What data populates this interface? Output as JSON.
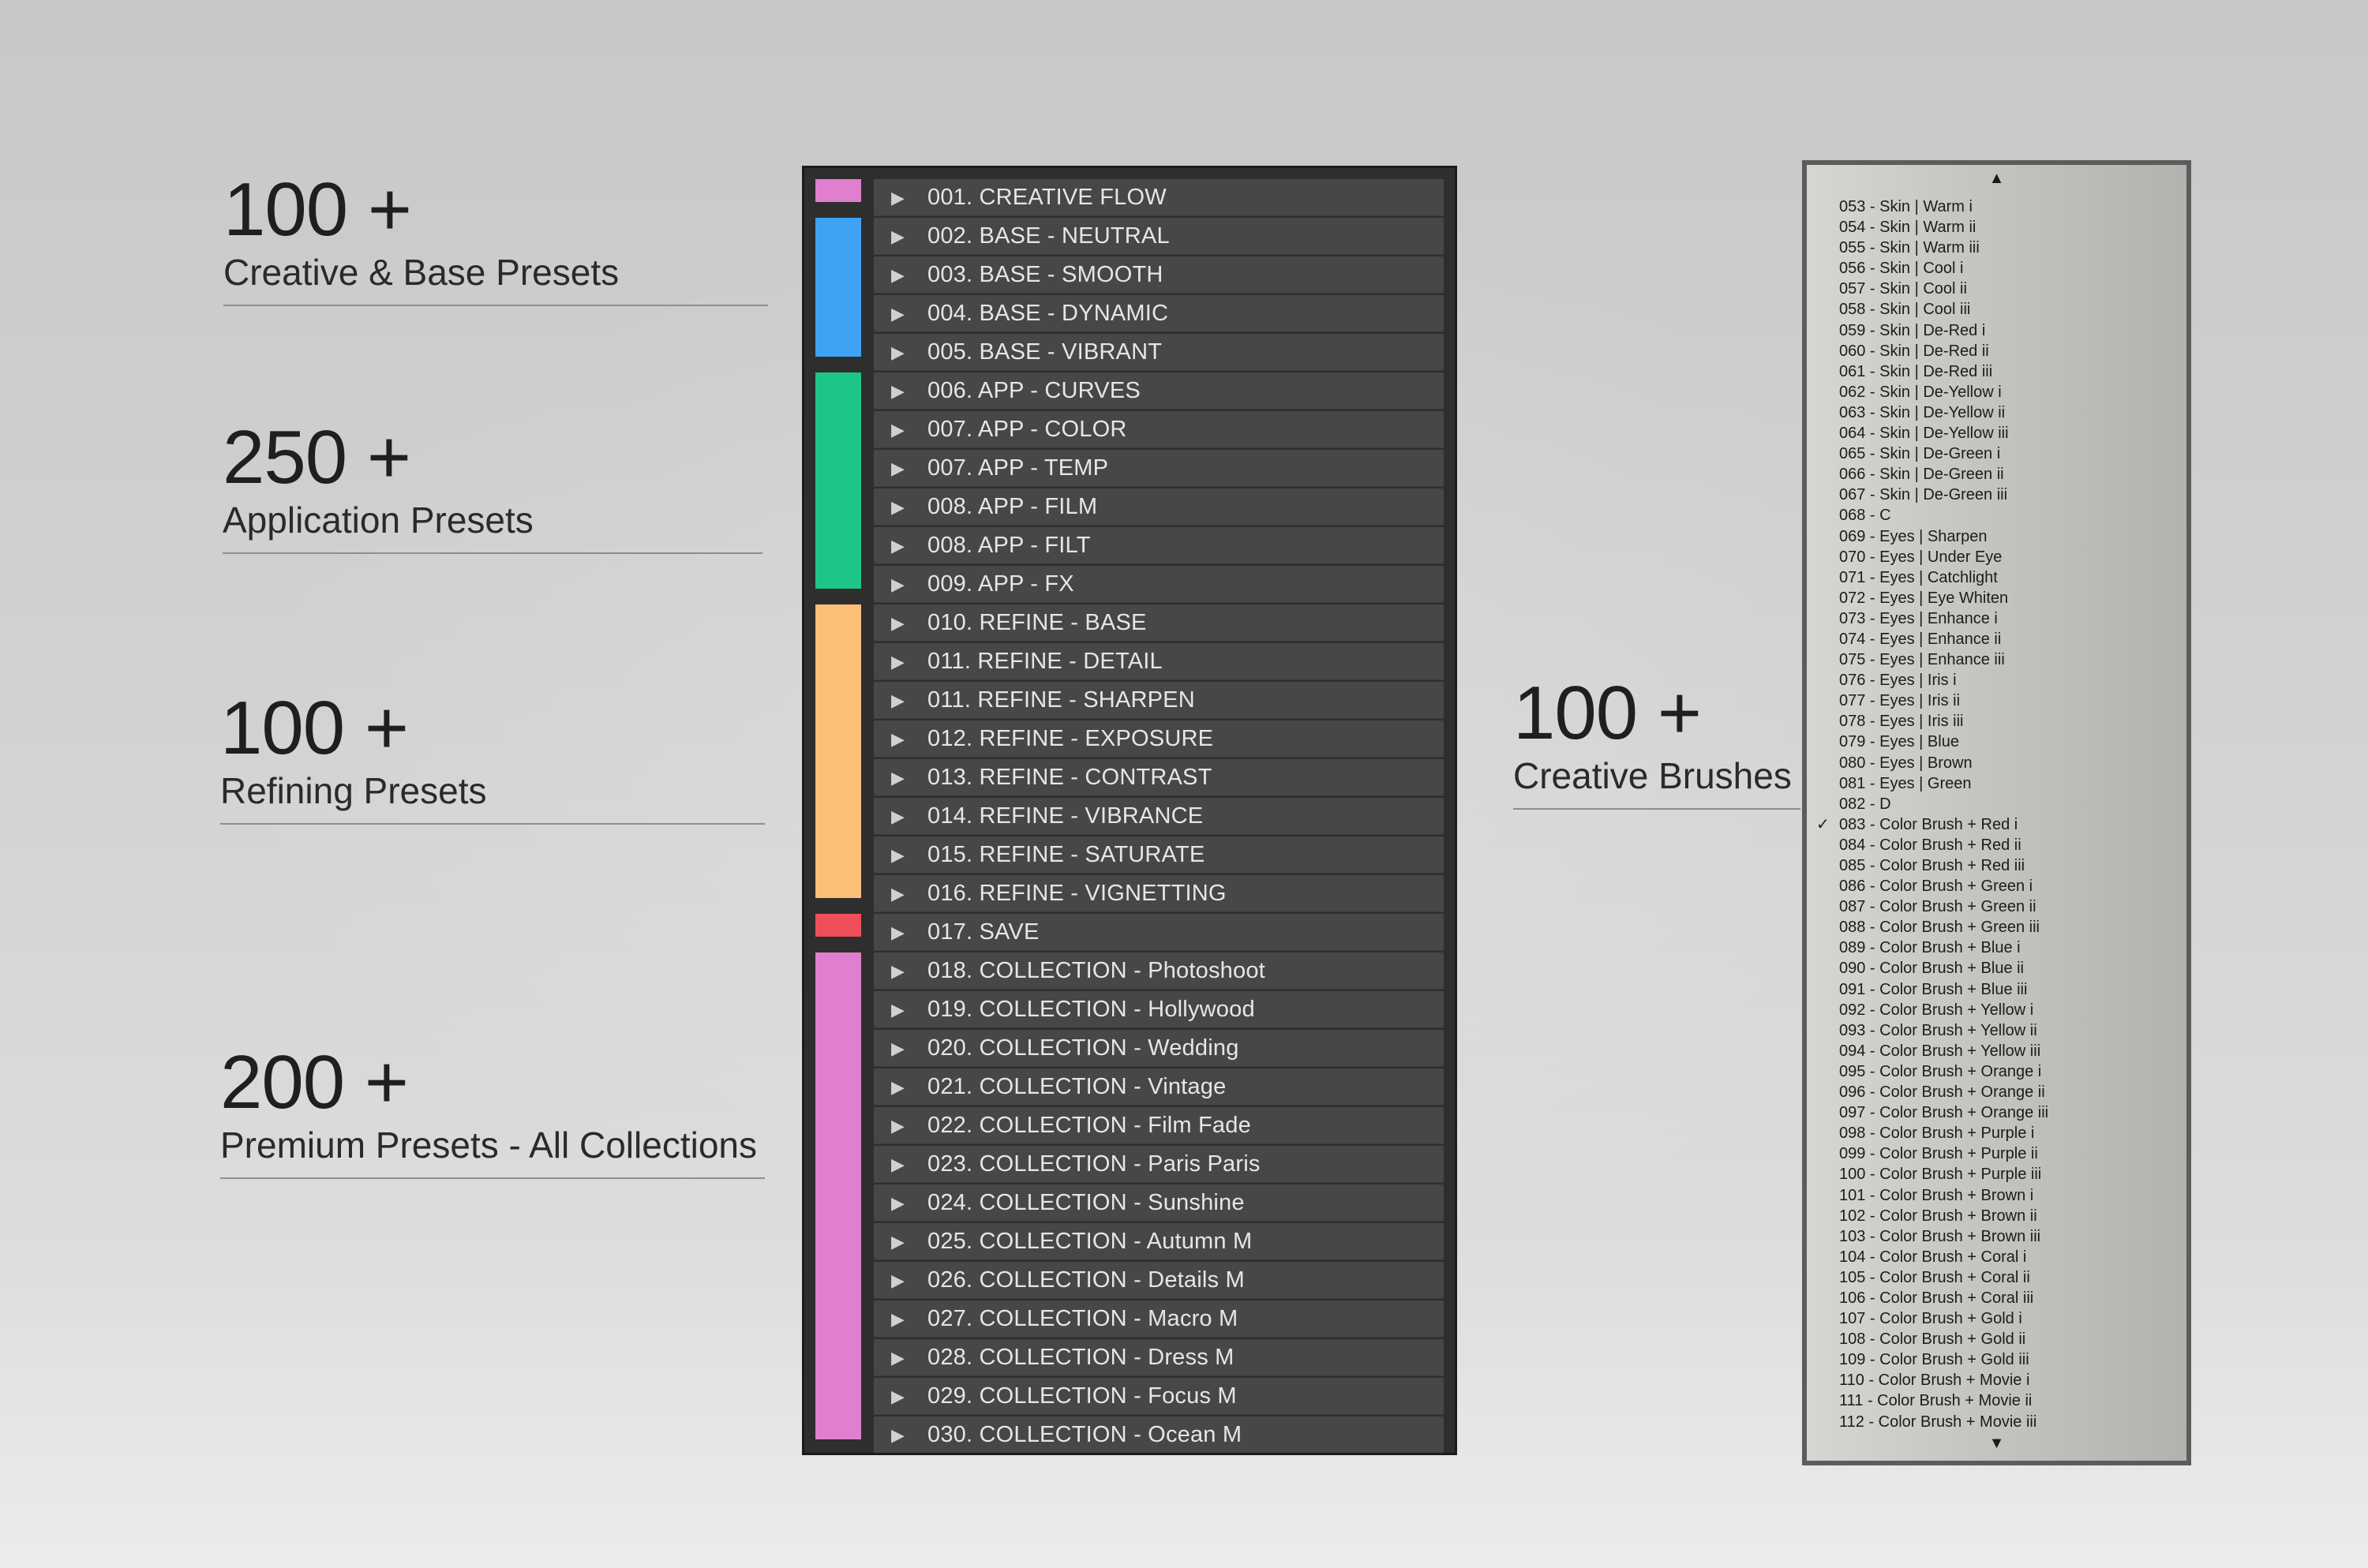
{
  "stats": [
    {
      "number": "100 +",
      "label": "Creative & Base Presets"
    },
    {
      "number": "250 +",
      "label": "Application Presets"
    },
    {
      "number": "100 +",
      "label": "Refining Presets"
    },
    {
      "number": "200 +",
      "label": "Premium Presets - All Collections"
    },
    {
      "number": "100 +",
      "label": "Creative Brushes"
    }
  ],
  "colors": {
    "pink": "#e07fcf",
    "blue": "#3fa3f5",
    "green": "#1dc688",
    "orange": "#fbbf78",
    "red": "#ef4f5b"
  },
  "preset_icon": "expand-triangle-icon",
  "presets": [
    {
      "name": "001. CREATIVE FLOW",
      "color": "pink"
    },
    {
      "name": "002. BASE - NEUTRAL",
      "color": "blue"
    },
    {
      "name": "003. BASE - SMOOTH",
      "color": "blue"
    },
    {
      "name": "004. BASE - DYNAMIC",
      "color": "blue"
    },
    {
      "name": "005. BASE - VIBRANT",
      "color": "blue"
    },
    {
      "name": "006. APP - CURVES",
      "color": "green"
    },
    {
      "name": "007. APP - COLOR",
      "color": "green"
    },
    {
      "name": "007. APP - TEMP",
      "color": "green"
    },
    {
      "name": "008. APP - FILM",
      "color": "green"
    },
    {
      "name": "008. APP - FILT",
      "color": "green"
    },
    {
      "name": "009. APP - FX",
      "color": "green"
    },
    {
      "name": "010. REFINE - BASE",
      "color": "orange"
    },
    {
      "name": "011. REFINE - DETAIL",
      "color": "orange"
    },
    {
      "name": "011. REFINE - SHARPEN",
      "color": "orange"
    },
    {
      "name": "012. REFINE - EXPOSURE",
      "color": "orange"
    },
    {
      "name": "013. REFINE - CONTRAST",
      "color": "orange"
    },
    {
      "name": "014. REFINE - VIBRANCE",
      "color": "orange"
    },
    {
      "name": "015. REFINE - SATURATE",
      "color": "orange"
    },
    {
      "name": "016. REFINE - VIGNETTING",
      "color": "orange"
    },
    {
      "name": "017. SAVE",
      "color": "red"
    },
    {
      "name": "018. COLLECTION - Photoshoot",
      "color": "pink"
    },
    {
      "name": "019. COLLECTION - Hollywood",
      "color": "pink"
    },
    {
      "name": "020. COLLECTION - Wedding",
      "color": "pink"
    },
    {
      "name": "021. COLLECTION - Vintage",
      "color": "pink"
    },
    {
      "name": "022. COLLECTION - Film Fade",
      "color": "pink"
    },
    {
      "name": "023. COLLECTION - Paris Paris",
      "color": "pink"
    },
    {
      "name": "024. COLLECTION - Sunshine",
      "color": "pink"
    },
    {
      "name": "025. COLLECTION - Autumn M",
      "color": "pink"
    },
    {
      "name": "026. COLLECTION - Details M",
      "color": "pink"
    },
    {
      "name": "027. COLLECTION - Macro M",
      "color": "pink"
    },
    {
      "name": "028. COLLECTION - Dress M",
      "color": "pink"
    },
    {
      "name": "029. COLLECTION - Focus M",
      "color": "pink"
    },
    {
      "name": "030. COLLECTION - Ocean M",
      "color": "pink"
    }
  ],
  "brush_list": {
    "scroll_up_icon": "▲",
    "scroll_down_icon": "▼",
    "check_mark": "✓",
    "items": [
      {
        "label": "053 - Skin | Warm i"
      },
      {
        "label": "054 - Skin | Warm ii"
      },
      {
        "label": "055 - Skin | Warm iii"
      },
      {
        "label": "056 - Skin | Cool i"
      },
      {
        "label": "057 - Skin | Cool ii"
      },
      {
        "label": "058 - Skin | Cool iii"
      },
      {
        "label": "059 - Skin | De-Red i"
      },
      {
        "label": "060 - Skin | De-Red ii"
      },
      {
        "label": "061 - Skin | De-Red iii"
      },
      {
        "label": "062 - Skin | De-Yellow i"
      },
      {
        "label": "063 - Skin | De-Yellow ii"
      },
      {
        "label": "064 - Skin | De-Yellow iii"
      },
      {
        "label": "065 - Skin | De-Green i"
      },
      {
        "label": "066 - Skin | De-Green ii"
      },
      {
        "label": "067 - Skin | De-Green iii"
      },
      {
        "label": "068 - C"
      },
      {
        "label": "069 - Eyes | Sharpen"
      },
      {
        "label": "070 - Eyes | Under Eye"
      },
      {
        "label": "071 - Eyes | Catchlight"
      },
      {
        "label": "072 - Eyes | Eye Whiten"
      },
      {
        "label": "073 - Eyes | Enhance i"
      },
      {
        "label": "074 - Eyes | Enhance ii"
      },
      {
        "label": "075 - Eyes | Enhance iii"
      },
      {
        "label": "076 - Eyes | Iris i"
      },
      {
        "label": "077 - Eyes | Iris ii"
      },
      {
        "label": "078 - Eyes | Iris iii"
      },
      {
        "label": "079 - Eyes | Blue"
      },
      {
        "label": "080 - Eyes | Brown"
      },
      {
        "label": "081 - Eyes | Green"
      },
      {
        "label": "082 - D"
      },
      {
        "label": "083 - Color Brush + Red i",
        "checked": true
      },
      {
        "label": "084 - Color Brush + Red ii"
      },
      {
        "label": "085 - Color Brush + Red iii"
      },
      {
        "label": "086 - Color Brush + Green i"
      },
      {
        "label": "087 - Color Brush + Green ii"
      },
      {
        "label": "088 - Color Brush + Green iii"
      },
      {
        "label": "089 - Color Brush + Blue i"
      },
      {
        "label": "090 - Color Brush + Blue ii"
      },
      {
        "label": "091 - Color Brush + Blue iii"
      },
      {
        "label": "092 - Color Brush + Yellow i"
      },
      {
        "label": "093 - Color Brush + Yellow ii"
      },
      {
        "label": "094 - Color Brush + Yellow iii"
      },
      {
        "label": "095 - Color Brush + Orange i"
      },
      {
        "label": "096 - Color Brush + Orange ii"
      },
      {
        "label": "097 - Color Brush + Orange iii"
      },
      {
        "label": "098 - Color Brush + Purple i"
      },
      {
        "label": "099 - Color Brush + Purple ii"
      },
      {
        "label": "100 - Color Brush + Purple iii"
      },
      {
        "label": "101 - Color Brush + Brown i"
      },
      {
        "label": "102 - Color Brush + Brown ii"
      },
      {
        "label": "103 - Color Brush + Brown iii"
      },
      {
        "label": "104 - Color Brush + Coral i"
      },
      {
        "label": "105 - Color Brush + Coral ii"
      },
      {
        "label": "106 - Color Brush + Coral iii"
      },
      {
        "label": "107 - Color Brush + Gold i"
      },
      {
        "label": "108 - Color Brush + Gold ii"
      },
      {
        "label": "109 - Color Brush + Gold iii"
      },
      {
        "label": "110 - Color Brush + Movie i"
      },
      {
        "label": "111 - Color Brush + Movie ii"
      },
      {
        "label": "112 - Color Brush + Movie iii"
      }
    ]
  }
}
